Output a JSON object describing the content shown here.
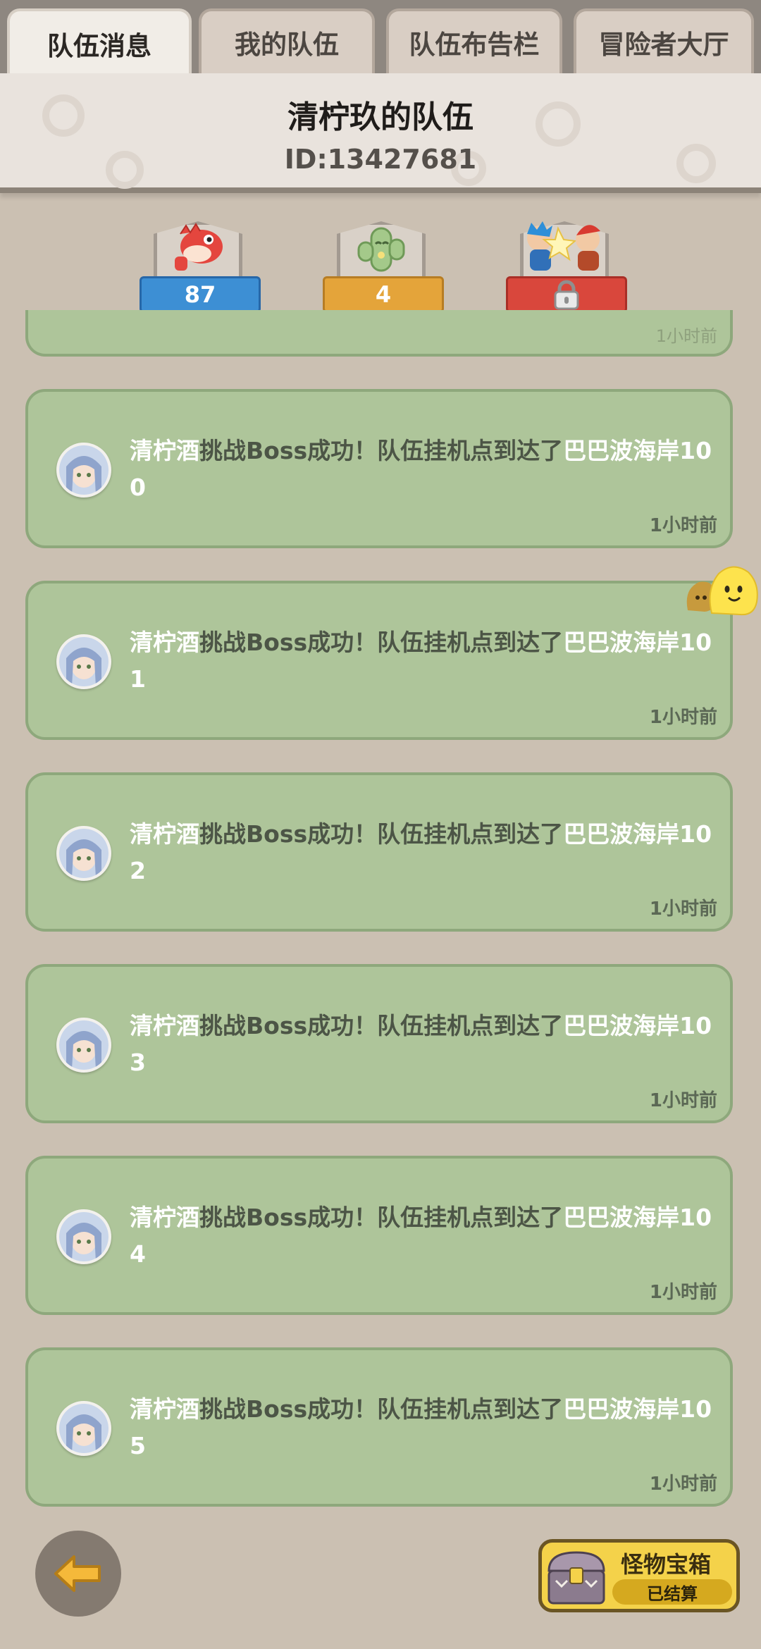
{
  "tabs": [
    {
      "label": "队伍消息",
      "active": true
    },
    {
      "label": "我的队伍",
      "active": false
    },
    {
      "label": "队伍布告栏",
      "active": false
    },
    {
      "label": "冒险者大厅",
      "active": false
    }
  ],
  "team": {
    "name": "清柠玖的队伍",
    "id": "ID:13427681"
  },
  "badges": [
    {
      "icon": "red-dinosaur-icon",
      "value": "87",
      "color": "#3d8fd4"
    },
    {
      "icon": "cactus-icon",
      "value": "4",
      "color": "#e4a43a"
    },
    {
      "icon": "battle-heroes-icon",
      "locked": true,
      "color": "#d9473c"
    }
  ],
  "partial_message": {
    "time": "1小时前"
  },
  "messages": [
    {
      "user": "清柠酒",
      "middle": "挑战Boss成功！队伍挂机点到达了",
      "place": "巴巴波海岸100",
      "time": "1小时前"
    },
    {
      "user": "清柠酒",
      "middle": "挑战Boss成功！队伍挂机点到达了",
      "place": "巴巴波海岸101",
      "time": "1小时前"
    },
    {
      "user": "清柠酒",
      "middle": "挑战Boss成功！队伍挂机点到达了",
      "place": "巴巴波海岸102",
      "time": "1小时前"
    },
    {
      "user": "清柠酒",
      "middle": "挑战Boss成功！队伍挂机点到达了",
      "place": "巴巴波海岸103",
      "time": "1小时前"
    },
    {
      "user": "清柠酒",
      "middle": "挑战Boss成功！队伍挂机点到达了",
      "place": "巴巴波海岸104",
      "time": "1小时前"
    },
    {
      "user": "清柠酒",
      "middle": "挑战Boss成功！队伍挂机点到达了",
      "place": "巴巴波海岸105",
      "time": "1小时前"
    }
  ],
  "chest": {
    "title": "怪物宝箱",
    "status": "已结算"
  }
}
